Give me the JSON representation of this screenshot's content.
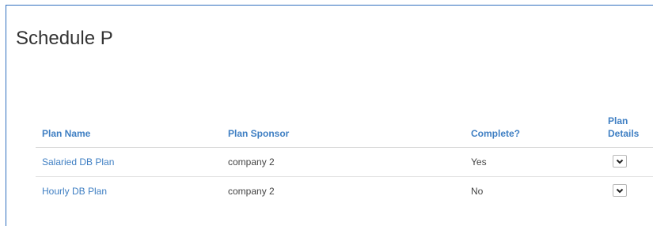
{
  "page": {
    "title": "Schedule P"
  },
  "table": {
    "headers": {
      "plan_name": "Plan Name",
      "plan_sponsor": "Plan Sponsor",
      "complete": "Complete?",
      "plan_details_line1": "Plan",
      "plan_details_line2": "Details"
    },
    "rows": [
      {
        "plan_name": "Salaried DB Plan",
        "plan_sponsor": "company 2",
        "complete": "Yes",
        "details_icon": "chevron-down-icon"
      },
      {
        "plan_name": "Hourly DB Plan",
        "plan_sponsor": "company 2",
        "complete": "No",
        "details_icon": "chevron-down-icon"
      }
    ]
  },
  "colors": {
    "frame_border": "#2f6fbe",
    "accent_link": "#3f7fc3",
    "title_text": "#333333",
    "body_text": "#444444"
  }
}
